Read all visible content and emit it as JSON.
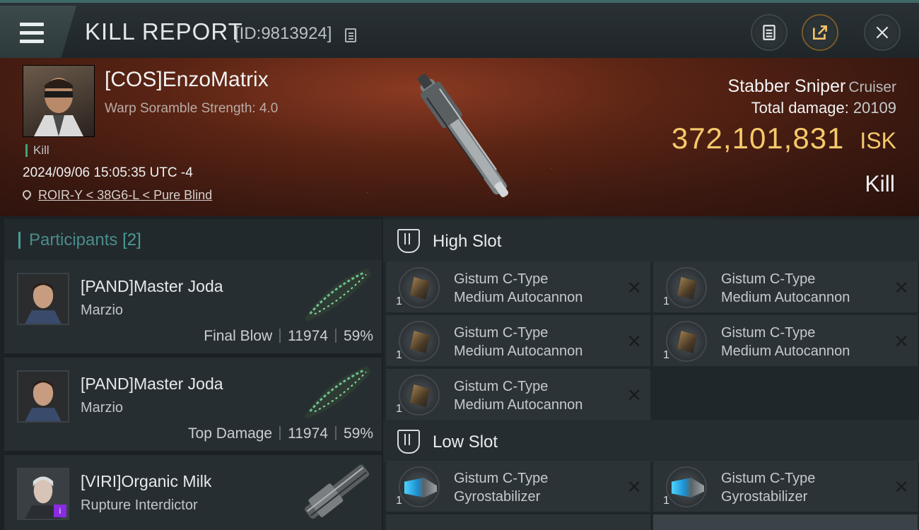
{
  "header": {
    "title": "KILL REPORT",
    "report_id": "[ID:9813924]"
  },
  "victim": {
    "name": "[COS]EnzoMatrix",
    "scramble": "Warp Soramble Strength: 4.0",
    "tag": "Kill",
    "timestamp": "2024/09/06 15:05:35 UTC -4",
    "location": "ROIR-Y < 38G6-L < Pure Blind",
    "ship_name": "Stabber Sniper",
    "ship_class": "Cruiser",
    "total_damage_label": "Total damage:",
    "total_damage": "20109",
    "isk_value": "372,101,831",
    "isk_unit": "ISK",
    "result": "Kill"
  },
  "participants": {
    "label": "Participants",
    "count": "[2]",
    "rows": [
      {
        "name": "[PAND]Master Joda",
        "sub": "Marzio",
        "role": "Final Blow",
        "damage": "11974",
        "percent": "59%"
      },
      {
        "name": "[PAND]Master Joda",
        "sub": "Marzio",
        "role": "Top Damage",
        "damage": "11974",
        "percent": "59%"
      },
      {
        "name": "[VIRI]Organic Milk",
        "sub": "Rupture Interdictor",
        "badge": "i"
      }
    ]
  },
  "fitting": {
    "high_slot_label": "High Slot",
    "low_slot_label": "Low Slot",
    "high": [
      {
        "line1": "Gistum C-Type",
        "line2": "Medium Autocannon",
        "qty": "1"
      },
      {
        "line1": "Gistum C-Type",
        "line2": "Medium Autocannon",
        "qty": "1"
      },
      {
        "line1": "Gistum C-Type",
        "line2": "Medium Autocannon",
        "qty": "1"
      },
      {
        "line1": "Gistum C-Type",
        "line2": "Medium Autocannon",
        "qty": "1"
      },
      {
        "line1": "Gistum C-Type",
        "line2": "Medium Autocannon",
        "qty": "1"
      }
    ],
    "low": [
      {
        "line1": "Gistum C-Type",
        "line2": "Gyrostabilizer",
        "qty": "1"
      },
      {
        "line1": "Gistum C-Type",
        "line2": "Gyrostabilizer",
        "qty": "1"
      }
    ],
    "close_glyph": "✕"
  },
  "colors": {
    "isk": "#f5c96b",
    "accent": "#4a9c97",
    "tag": "#3fa47a"
  },
  "icons": [
    "menu-icon",
    "copy-icon",
    "clipboard-icon",
    "share-icon",
    "close-icon",
    "location-pin-icon",
    "slot-icon"
  ]
}
